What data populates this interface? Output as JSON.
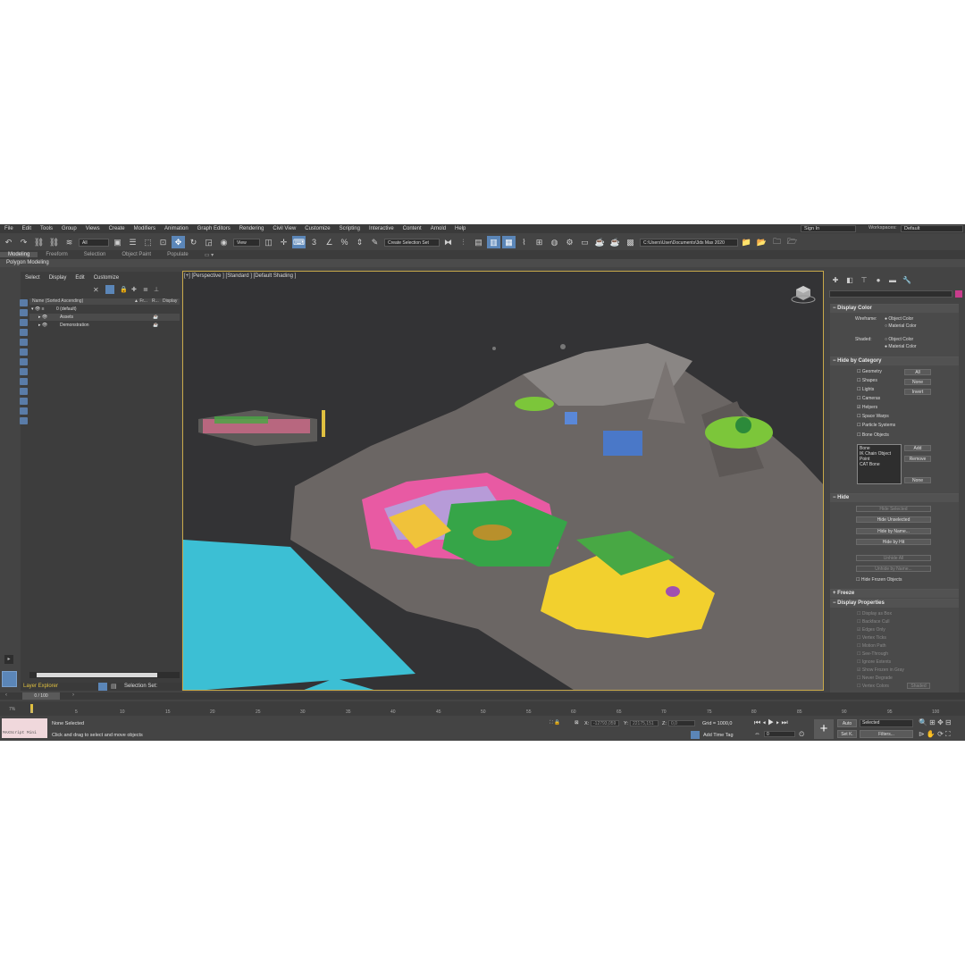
{
  "menu": [
    "File",
    "Edit",
    "Tools",
    "Group",
    "Views",
    "Create",
    "Modifiers",
    "Animation",
    "Graph Editors",
    "Rendering",
    "Civil View",
    "Customize",
    "Scripting",
    "Interactive",
    "Content",
    "Arnold",
    "Help"
  ],
  "signin": "Sign In",
  "workspace_label": "Workspaces:",
  "workspace_value": "Default",
  "toolbar": {
    "filter_value": "All",
    "view_value": "View",
    "selection_set": "Create Selection Set",
    "path": "C:\\Users\\User\\Documents\\3ds Max 2020"
  },
  "ribbon_tabs": [
    "Modeling",
    "Freeform",
    "Selection",
    "Object Paint",
    "Populate"
  ],
  "ribbon_sub": "Polygon Modeling",
  "scene_explorer": {
    "menu": [
      "Select",
      "Display",
      "Edit",
      "Customize"
    ],
    "col_name": "Name (Sorted Ascending)",
    "col_fr": "▲ Fr...",
    "col_r": "R...",
    "col_display": "Display",
    "rows": [
      "0 (default)",
      "Assets",
      "Demonstration"
    ],
    "footer_label": "Layer Explorer",
    "selection_set_label": "Selection Set:"
  },
  "viewport_label": "[+] [Perspective ] [Standard ] [Default Shading ]",
  "command_panel": {
    "display_color": {
      "title": "Display Color",
      "wireframe": "Wireframe:",
      "shaded": "Shaded:",
      "object_color": "Object Color",
      "material_color": "Material Color"
    },
    "hide_by_category": {
      "title": "Hide by Category",
      "items": [
        "Geometry",
        "Shapes",
        "Lights",
        "Cameras",
        "Helpers",
        "Space Warps",
        "Particle Systems",
        "Bone Objects"
      ],
      "btn_all": "All",
      "btn_none": "None",
      "btn_invert": "Invert",
      "list": [
        "Bone",
        "IK Chain Object",
        "Point",
        "CAT Bone"
      ],
      "btn_add": "Add",
      "btn_remove": "Remove",
      "btn_none2": "None"
    },
    "hide": {
      "title": "Hide",
      "buttons": [
        "Hide Selected",
        "Hide Unselected",
        "Hide by Name...",
        "Hide by Hit",
        "Unhide All",
        "Unhide by Name..."
      ],
      "frozen": "Hide Frozen Objects"
    },
    "freeze": {
      "title": "Freeze"
    },
    "display_properties": {
      "title": "Display Properties",
      "items": [
        "Display as Box",
        "Backface Cull",
        "Edges Only",
        "Vertex Ticks",
        "Motion Path",
        "See-Through",
        "Ignore Extents",
        "Show Frozen in Gray",
        "Never Degrade",
        "Vertex Colors"
      ],
      "shaded_btn": "Shaded"
    }
  },
  "timeline": {
    "frame": "0 / 100",
    "ticks": [
      "0",
      "5",
      "10",
      "15",
      "20",
      "25",
      "30",
      "35",
      "40",
      "45",
      "50",
      "55",
      "60",
      "65",
      "70",
      "75",
      "80",
      "85",
      "90",
      "95",
      "100"
    ]
  },
  "status": {
    "maxscript": "MAXScript Mini",
    "none_selected": "None Selected",
    "hint": "Click and drag to select and move objects",
    "x_label": "X:",
    "x_val": "-12793,059",
    "y_label": "Y:",
    "y_val": "22175,151",
    "z_label": "Z:",
    "z_val": "0,0",
    "grid": "Grid = 1000,0",
    "add_time_tag": "Add Time Tag",
    "auto": "Auto",
    "selected": "Selected",
    "set_k": "Set K.",
    "filters": "Filters...",
    "frame_field": "0",
    "percent": "7%"
  }
}
